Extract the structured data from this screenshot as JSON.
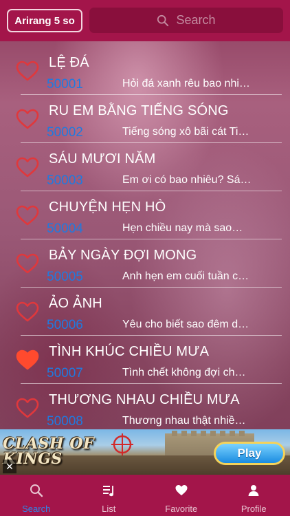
{
  "header": {
    "brand_label": "Arirang 5 so",
    "search_placeholder": "Search",
    "search_icon": "magnifier-icon"
  },
  "songs": [
    {
      "title": "LỆ ĐÁ",
      "code": "50001",
      "lyric": "Hỏi đá xanh rêu bao nhi…",
      "favorite": false
    },
    {
      "title": "RU EM BẰNG TIẾNG SÓNG",
      "code": "50002",
      "lyric": "Tiếng sóng xô bãi cát Ti…",
      "favorite": false
    },
    {
      "title": "SÁU MƯƠI NĂM",
      "code": "50003",
      "lyric": "Em ơi có bao nhiêu? Sá…",
      "favorite": false
    },
    {
      "title": "CHUYỆN HẸN HÒ",
      "code": "50004",
      "lyric": "Hẹn chiều nay mà sao…",
      "favorite": false
    },
    {
      "title": "BẢY NGÀY ĐỢI MONG",
      "code": "50005",
      "lyric": "Anh hẹn em cuối tuần c…",
      "favorite": false
    },
    {
      "title": "ẢO ẢNH",
      "code": "50006",
      "lyric": "Yêu cho biết sao đêm d…",
      "favorite": false
    },
    {
      "title": "TÌNH KHÚC CHIỀU MƯA",
      "code": "50007",
      "lyric": "Tình chết không đợi ch…",
      "favorite": true
    },
    {
      "title": "THƯƠNG NHAU CHIỀU MƯA",
      "code": "50008",
      "lyric": "Thương nhau thật nhiề…",
      "favorite": false
    }
  ],
  "ad": {
    "logo_line1": "CLASH OF",
    "logo_line2": "KINGS",
    "play_label": "Play",
    "close_label": "✕"
  },
  "tabs": [
    {
      "label": "Search",
      "icon": "search-icon",
      "active": true
    },
    {
      "label": "List",
      "icon": "music-list-icon",
      "active": false
    },
    {
      "label": "Favorite",
      "icon": "heart-icon",
      "active": false
    },
    {
      "label": "Profile",
      "icon": "person-icon",
      "active": false
    }
  ],
  "colors": {
    "header_bg": "#a3154a",
    "heart_outline": "#e0383c",
    "heart_filled": "#ff4a2e",
    "code_blue": "#1f7ae0",
    "active_tab": "#2f86e8",
    "inactive_tab": "#e8c4d1"
  }
}
